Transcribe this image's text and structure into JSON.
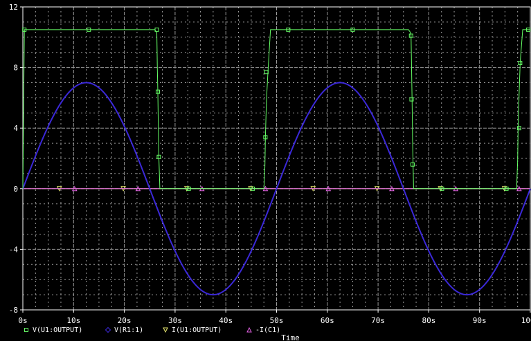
{
  "chart_data": {
    "type": "line",
    "title": "",
    "xlabel": "Time",
    "ylabel": "",
    "xlim": [
      0,
      100
    ],
    "ylim": [
      -8,
      12
    ],
    "x_ticks": [
      0,
      10,
      20,
      30,
      40,
      50,
      60,
      70,
      80,
      90,
      100
    ],
    "x_tick_labels": [
      "0s",
      "10s",
      "20s",
      "30s",
      "40s",
      "50s",
      "60s",
      "70s",
      "80s",
      "90s",
      "100s"
    ],
    "y_ticks": [
      -8,
      -4,
      0,
      4,
      8,
      12
    ],
    "y_tick_labels": [
      "-8",
      "-4",
      "0",
      "4",
      "8",
      "12"
    ],
    "grid": true,
    "background": "#000000",
    "legend_position": "bottom",
    "series": [
      {
        "name": "V(U1:OUTPUT)",
        "color": "#66ff66",
        "marker": "square",
        "x": [
          0,
          0.3,
          13,
          26.0,
          26.4,
          26.5,
          26.6,
          26.7,
          26.8,
          27.0,
          32.7,
          45.3,
          47.5,
          47.7,
          47.8,
          48.0,
          48.3,
          48.8,
          52.3,
          65,
          76.0,
          76.4,
          76.5,
          76.6,
          76.7,
          76.8,
          77.0,
          82.6,
          95.3,
          97.3,
          97.5,
          97.6,
          97.8,
          98.0,
          98.5,
          100
        ],
        "y": [
          0,
          10.5,
          10.5,
          10.5,
          10.3,
          8.0,
          6.4,
          4.0,
          2.1,
          0,
          0,
          0,
          0,
          1.5,
          3.4,
          5.8,
          7.7,
          10.5,
          10.5,
          10.5,
          10.5,
          10.3,
          10.1,
          8.0,
          5.9,
          3.2,
          0,
          0,
          0,
          0,
          1.8,
          4.0,
          6.3,
          8.3,
          10.5,
          10.5
        ],
        "marker_x": [
          0.3,
          13,
          26.4,
          26.6,
          26.8,
          32.7,
          45.3,
          47.8,
          48.0,
          52.3,
          65,
          76.5,
          76.6,
          76.8,
          82.6,
          95.3,
          97.8,
          98.0,
          99.6
        ],
        "marker_y": [
          10.5,
          10.5,
          10.5,
          6.4,
          2.1,
          0,
          0,
          3.4,
          7.7,
          10.5,
          10.5,
          10.1,
          5.9,
          1.6,
          0,
          0,
          4.0,
          8.3,
          10.5
        ]
      },
      {
        "name": "V(R1:1)",
        "color": "#3b28d8",
        "marker": "diamond",
        "function": "sine",
        "amplitude": 7,
        "period": 50,
        "phase": 0
      },
      {
        "name": "I(U1:OUTPUT)",
        "color": "#e8e870",
        "marker": "triangle-down",
        "x": [
          0,
          100
        ],
        "y": [
          0,
          0
        ],
        "marker_x": [
          7.2,
          19.8,
          32.3,
          44.9,
          57.2,
          69.8,
          82.3,
          94.9
        ],
        "marker_y": [
          0,
          0,
          0,
          0,
          0,
          0,
          0,
          0
        ]
      },
      {
        "name": "-I(C1)",
        "color": "#e060e0",
        "marker": "triangle-up",
        "x": [
          0,
          100
        ],
        "y": [
          0,
          0
        ],
        "marker_x": [
          10.2,
          22.7,
          35.3,
          47.8,
          60.2,
          72.7,
          85.3,
          97.8
        ],
        "marker_y": [
          0,
          0,
          0,
          0,
          0,
          0,
          0,
          0
        ]
      }
    ]
  }
}
